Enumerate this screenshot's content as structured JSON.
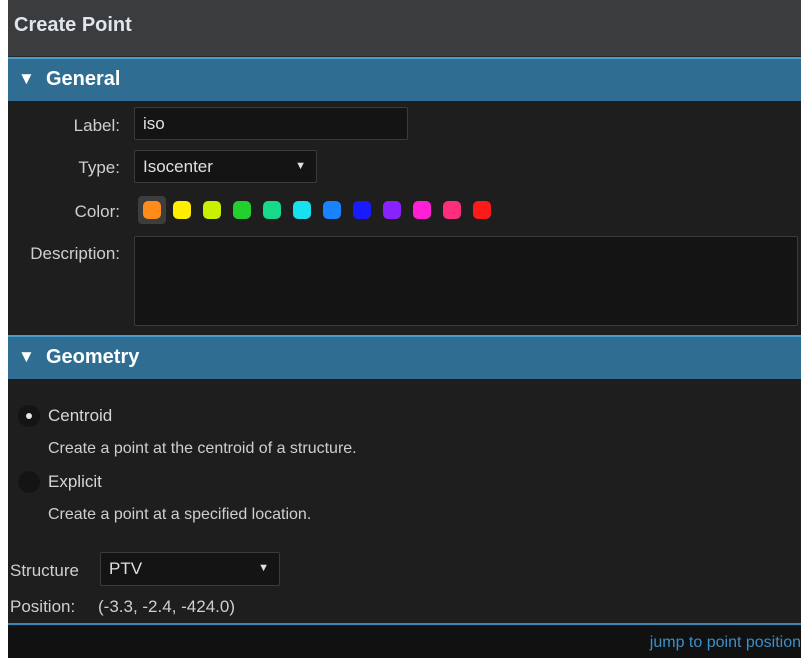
{
  "window": {
    "title": "Create Point"
  },
  "general": {
    "header": "General",
    "label_field": {
      "label": "Label:",
      "value": "iso"
    },
    "type_field": {
      "label": "Type:",
      "value": "Isocenter"
    },
    "color_field": {
      "label": "Color:",
      "selected_index": 0,
      "swatches": [
        "#ff8c1a",
        "#ffee00",
        "#c8f000",
        "#22d12e",
        "#16d98a",
        "#19e0ee",
        "#1a82ff",
        "#1a1aff",
        "#8a22ff",
        "#ff1fd6",
        "#ff2d7d",
        "#ff1a1a"
      ]
    },
    "description_field": {
      "label": "Description:",
      "value": ""
    }
  },
  "geometry": {
    "header": "Geometry",
    "options": [
      {
        "label": "Centroid",
        "description": "Create a point at the centroid of a structure.",
        "selected": true
      },
      {
        "label": "Explicit",
        "description": "Create a point at a specified location.",
        "selected": false
      }
    ],
    "structure_field": {
      "label": "Structure",
      "value": "PTV"
    },
    "position": {
      "label": "Position:",
      "value": "(-3.3, -2.4, -424.0)"
    }
  },
  "footer": {
    "link": "jump to point position"
  },
  "icons": {
    "collapse": "triangle-down-icon",
    "dropdown": "caret-down-icon"
  }
}
